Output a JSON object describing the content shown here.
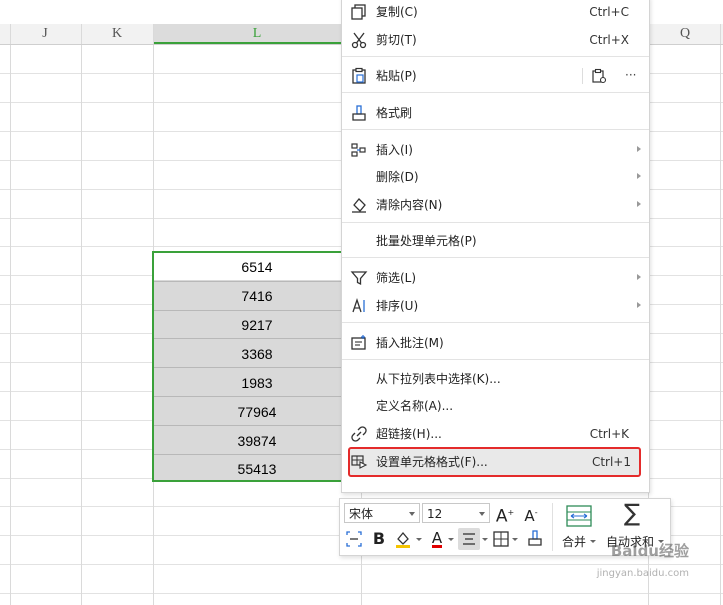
{
  "columns": [
    "J",
    "K",
    "L",
    "",
    "Q"
  ],
  "cells": [
    "6514",
    "7416",
    "9217",
    "3368",
    "1983",
    "77964",
    "39874",
    "55413"
  ],
  "menu": {
    "copy": {
      "label": "复制(C)",
      "shortcut": "Ctrl+C"
    },
    "cut": {
      "label": "剪切(T)",
      "shortcut": "Ctrl+X"
    },
    "paste": {
      "label": "粘贴(P)",
      "more": "···"
    },
    "format_painter": {
      "label": "格式刷"
    },
    "insert": {
      "label": "插入(I)"
    },
    "delete": {
      "label": "删除(D)"
    },
    "clear": {
      "label": "清除内容(N)"
    },
    "batch": {
      "label": "批量处理单元格(P)"
    },
    "filter": {
      "label": "筛选(L)"
    },
    "sort": {
      "label": "排序(U)"
    },
    "insert_comment": {
      "label": "插入批注(M)"
    },
    "pick_list": {
      "label": "从下拉列表中选择(K)..."
    },
    "define_name": {
      "label": "定义名称(A)..."
    },
    "hyperlink": {
      "label": "超链接(H)...",
      "shortcut": "Ctrl+K"
    },
    "format_cells": {
      "label": "设置单元格格式(F)...",
      "shortcut": "Ctrl+1"
    }
  },
  "toolbar": {
    "font_name": "宋体",
    "font_size": "12",
    "bold": "B",
    "increase_font": "A",
    "decrease_font": "A",
    "merge_label": "合并",
    "autosum_label": "自动求和"
  },
  "watermark": {
    "line1": "Baidu经验",
    "line2": "jingyan.baidu.com"
  },
  "colors": {
    "selection": "#3aa13a",
    "highlight_border": "#e42b2b",
    "font_color": "#e00000",
    "fill_color": "#f5c400"
  },
  "icons": [
    "copy-icon",
    "scissors-icon",
    "paste-icon",
    "format-painter-icon",
    "insert-icon",
    "clear-icon",
    "filter-icon",
    "sort-icon",
    "comment-icon",
    "link-icon",
    "format-cells-icon"
  ]
}
